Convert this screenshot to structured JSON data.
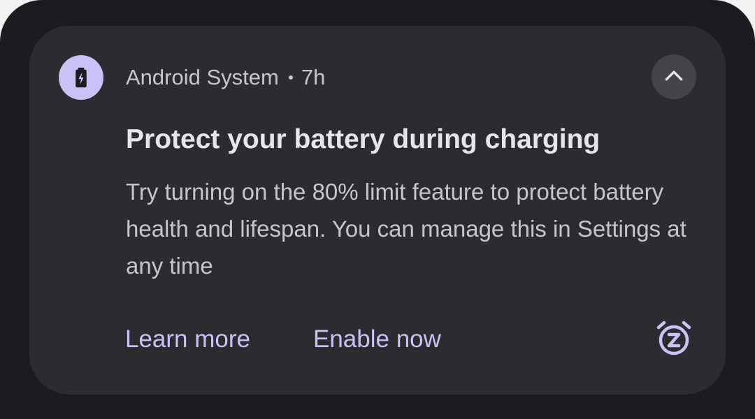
{
  "notification": {
    "app_icon": "battery-charging-icon",
    "app_name": "Android System",
    "time": "7h",
    "collapse_icon": "chevron-up-icon",
    "title": "Protect your battery during charging",
    "body": "Try turning on the 80% limit feature to protect battery health and lifespan. You can manage this in Settings at any time",
    "actions": [
      {
        "label": "Learn more"
      },
      {
        "label": "Enable now"
      }
    ],
    "snooze_icon": "snooze-alarm-icon",
    "colors": {
      "accent": "#cbc1f7",
      "card_bg": "#2c2b30",
      "shade_bg": "#1c1b1f",
      "title": "#e7e5ea",
      "text": "#c7c5cc"
    }
  }
}
